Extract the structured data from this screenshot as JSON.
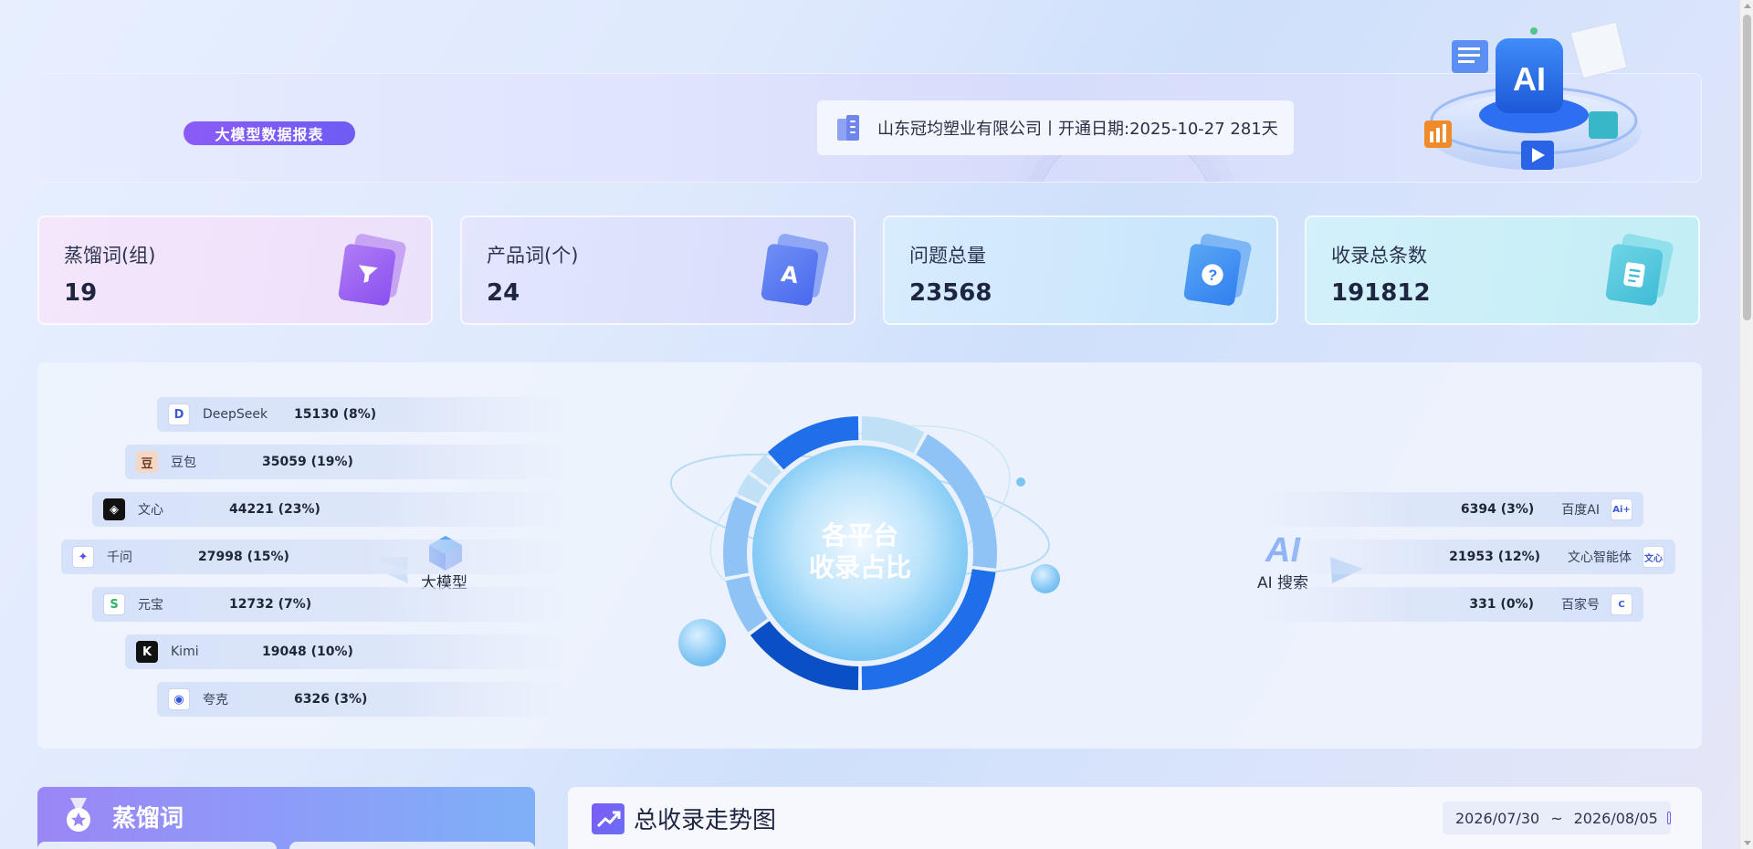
{
  "header": {
    "report_badge": "大模型数据报表",
    "company_line": "山东冠均塑业有限公司丨开通日期:2025-10-27 281天"
  },
  "stats": [
    {
      "label": "蒸馏词(组)",
      "value": "19",
      "icon": "filter-icon"
    },
    {
      "label": "产品词(个)",
      "value": "24",
      "icon": "letter-a-icon"
    },
    {
      "label": "问题总量",
      "value": "23568",
      "icon": "question-icon"
    },
    {
      "label": "收录总条数",
      "value": "191812",
      "icon": "document-icon"
    }
  ],
  "distribution": {
    "center_title_line1": "各平台",
    "center_title_line2": "收录占比",
    "left_group_label": "大模型",
    "right_group_label": "AI 搜索",
    "left_items": [
      {
        "name": "DeepSeek",
        "value": "15130 (8%)",
        "icon": "deepseek-logo-icon"
      },
      {
        "name": "豆包",
        "value": "35059 (19%)",
        "icon": "doubao-logo-icon"
      },
      {
        "name": "文心",
        "value": "44221 (23%)",
        "icon": "wenxin-logo-icon"
      },
      {
        "name": "千问",
        "value": "27998 (15%)",
        "icon": "qianwen-logo-icon"
      },
      {
        "name": "元宝",
        "value": "12732 (7%)",
        "icon": "yuanbao-logo-icon"
      },
      {
        "name": "Kimi",
        "value": "19048 (10%)",
        "icon": "kimi-logo-icon"
      },
      {
        "name": "夸克",
        "value": "6326 (3%)",
        "icon": "quark-logo-icon"
      }
    ],
    "right_items": [
      {
        "name": "百度AI",
        "value": "6394 (3%)",
        "icon": "baidu-ai-logo-icon",
        "logo_text": "Ai+"
      },
      {
        "name": "文心智能体",
        "value": "21953 (12%)",
        "icon": "wenxin-agent-logo-icon",
        "logo_text": "文心"
      },
      {
        "name": "百家号",
        "value": "331 (0%)",
        "icon": "baijiahao-logo-icon",
        "logo_text": "C"
      }
    ],
    "donut_shares": [
      8,
      19,
      23,
      15,
      7,
      10,
      3,
      3,
      12,
      0
    ],
    "colors": {
      "ring_dark": "#0b4fc7",
      "ring_mid": "#1f6fea",
      "ring_light": "#8fc3f5",
      "ring_pale": "#bfe0f5"
    }
  },
  "keywords_panel": {
    "title": "蒸馏词",
    "icon": "medal-icon"
  },
  "trend_panel": {
    "title": "总收录走势图",
    "date_start": "2026/07/30",
    "date_separator": "~",
    "date_end": "2026/08/05",
    "icon": "trend-up-icon"
  }
}
